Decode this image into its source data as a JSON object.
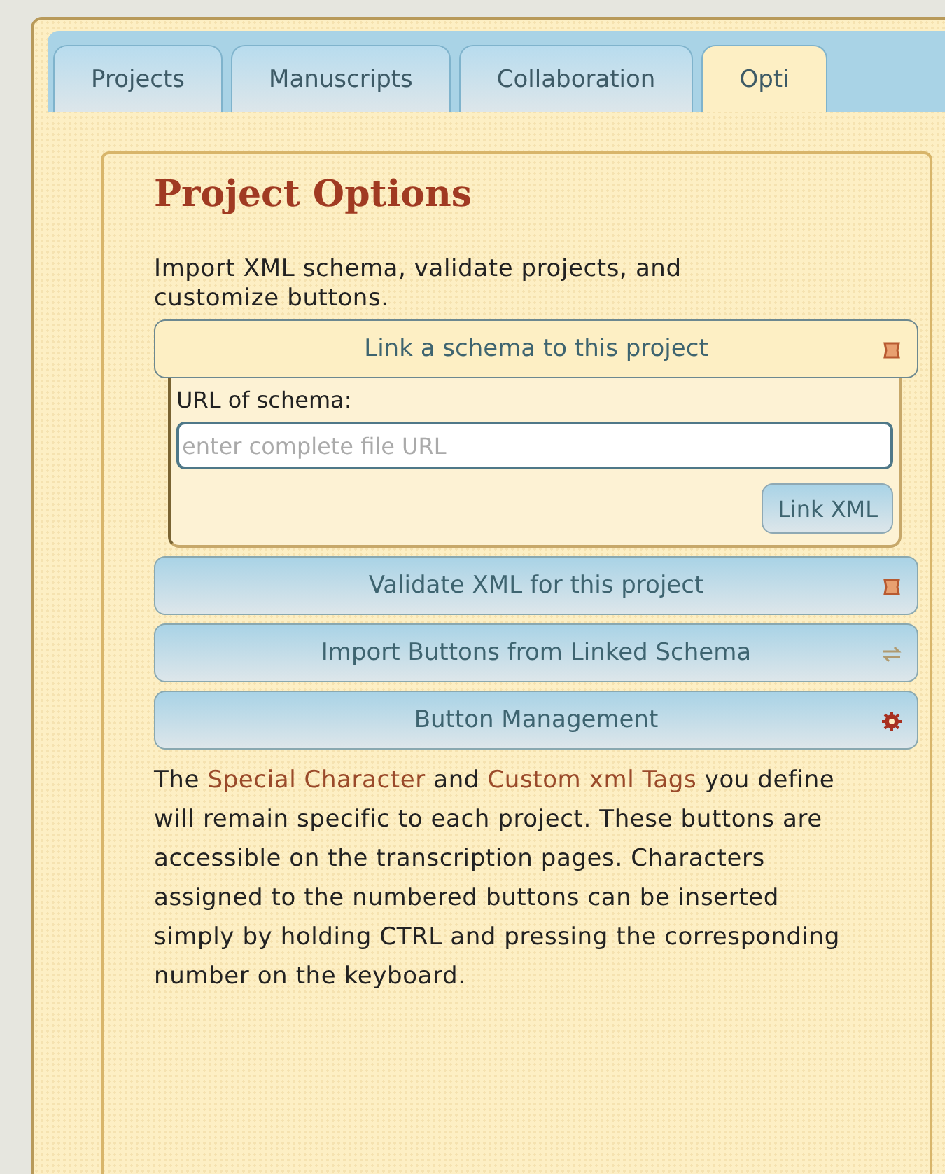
{
  "tabs": [
    {
      "label": "Projects",
      "selected": false
    },
    {
      "label": "Manuscripts",
      "selected": false
    },
    {
      "label": "Collaboration",
      "selected": false
    },
    {
      "label": "Opti",
      "selected": true
    }
  ],
  "panel": {
    "title": "Project Options",
    "intro": "Import XML schema, validate projects, and customize buttons.",
    "sections": [
      {
        "kind": "expander",
        "label": "Link a schema to this project",
        "expanded": true,
        "field_label": "URL of schema:",
        "placeholder": "enter complete file URL",
        "submit": "Link XML"
      },
      {
        "kind": "action",
        "label": "Validate XML for this project"
      },
      {
        "kind": "action",
        "label": "Import Buttons from Linked Schema"
      },
      {
        "kind": "action",
        "label": "Button Management"
      }
    ],
    "note": [
      {
        "kind": "text",
        "text": "The "
      },
      {
        "kind": "link",
        "text": "Special Character"
      },
      {
        "kind": "text",
        "text": " and "
      },
      {
        "kind": "link",
        "text": "Custom xml Tags"
      },
      {
        "kind": "text",
        "text": " you define will remain specific to each project. These buttons are accessible on the transcription pages. Characters assigned to the numbered buttons can be inserted simply by holding CTRL and pressing the corresponding number on the keyboard."
      }
    ]
  }
}
